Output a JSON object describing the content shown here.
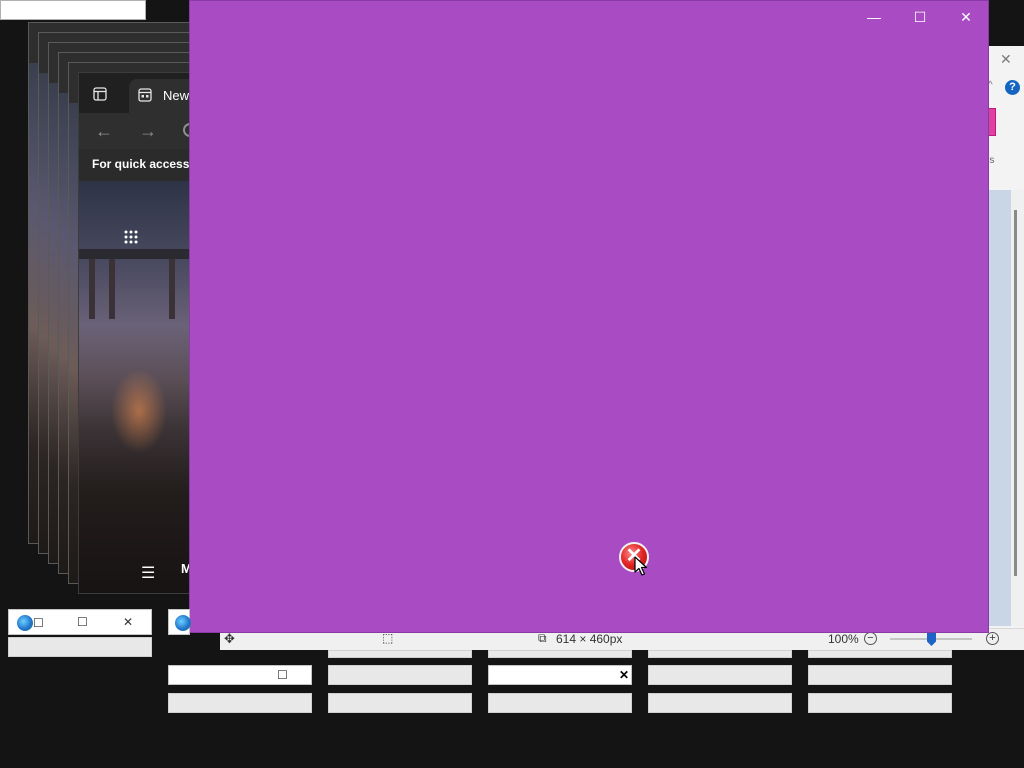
{
  "browser": {
    "tab_title": "New",
    "favorites_bar_text": "For quick access, p",
    "back_glyph": "←",
    "forward_glyph": "→",
    "apps_glyph": "⋮⋮⋮",
    "menu_glyph": "☰",
    "bottom_text": "M"
  },
  "main_window": {
    "background_color": "#a94cc4",
    "minimize_glyph": "—",
    "maximize_glyph": "☐",
    "close_glyph": "✕",
    "error_glyph": "✕"
  },
  "paint_window": {
    "close_glyph": "✕",
    "collapse_glyph": "^",
    "help_glyph": "?",
    "label_1": "t",
    "label_2": "rs",
    "status": {
      "move_glyph": "✥",
      "selection_glyph": "⬚",
      "size_glyph": "⧉",
      "image_size": "614 × 460px",
      "zoom": "100%",
      "zoom_value_percent": 100,
      "zoom_out_glyph": "−",
      "zoom_in_glyph": "+"
    }
  },
  "thumbnails": {
    "restore_glyph": "☐",
    "close_glyph": "✕",
    "max_glyph": "☐",
    "bold_close_glyph": "✕"
  },
  "colors": {
    "desktop": "#141414",
    "purple": "#a94cc4",
    "accent_blue": "#1e63c6",
    "error_red": "#e02424"
  },
  "icons": [
    "layout-icon",
    "newtab-icon",
    "back-arrow-icon",
    "forward-arrow-icon",
    "refresh-icon",
    "apps-grid-icon",
    "hamburger-menu-icon",
    "minimize-icon",
    "maximize-icon",
    "close-icon",
    "error-icon",
    "cursor-icon",
    "help-icon",
    "move-icon",
    "selection-icon",
    "image-size-icon",
    "zoom-out-icon",
    "zoom-in-icon",
    "ie-logo-icon"
  ]
}
